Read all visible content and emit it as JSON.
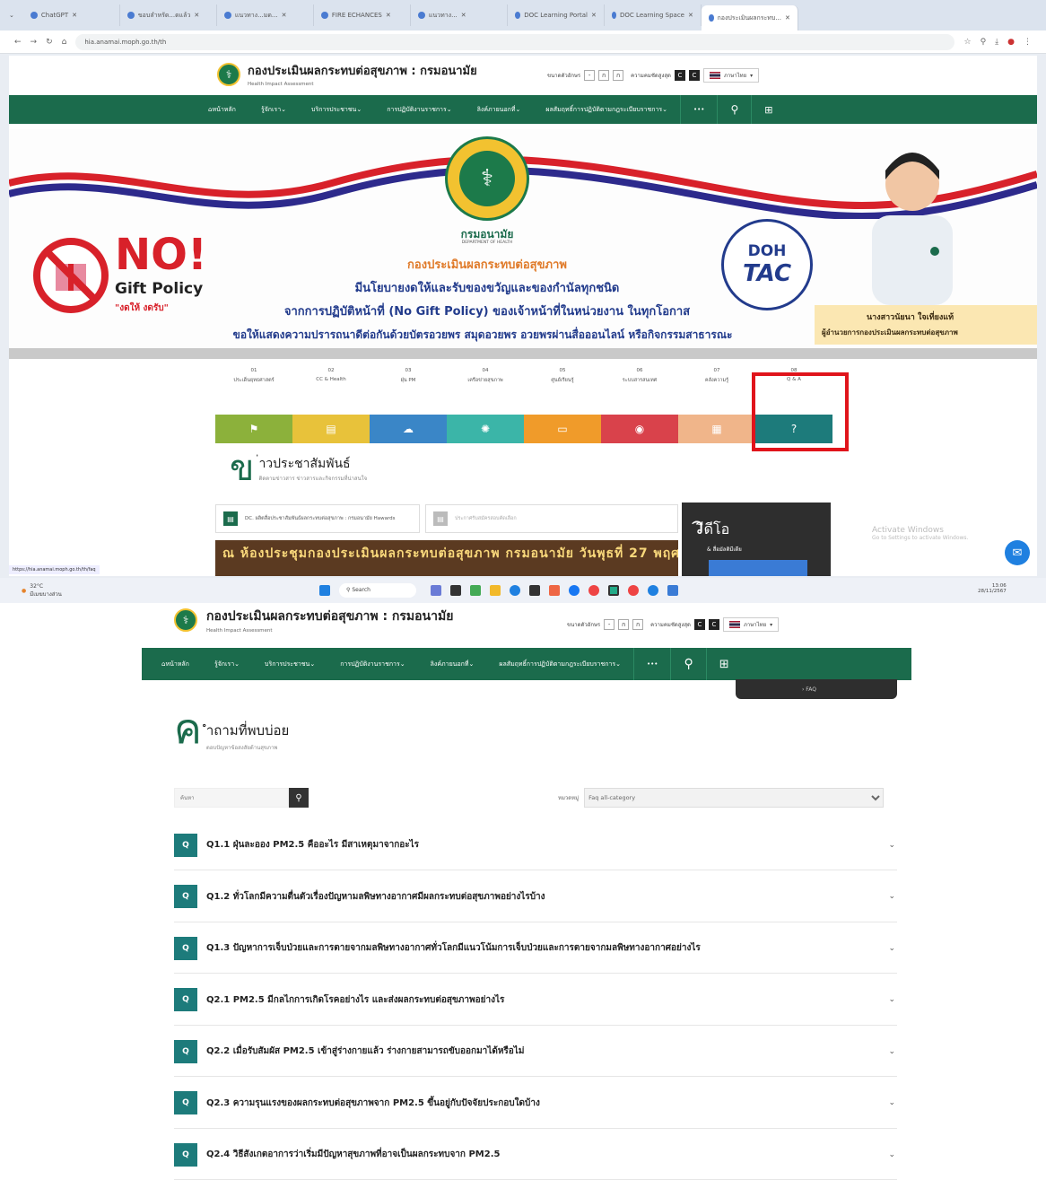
{
  "browser": {
    "tabs": [
      "ChatGPT",
      "ขอบลำหรัด...ดแล้ว",
      "แนวทาง...มด...",
      "FIRE ECHANCES",
      "แนวทาง...",
      "DOC Learning Portal",
      "DOC Learning Space",
      "กองประเมินผลกระทบ..."
    ],
    "url": "hia.anamai.moph.go.th/th"
  },
  "site": {
    "title": "กองประเมินผลกระทบต่อสุขภาพ : กรมอนามัย",
    "subtitle": "Health Impact Assessment",
    "font_size_label": "ขนาดตัวอักษร",
    "font_btns": [
      "-",
      "ก",
      "ก"
    ],
    "contrast_label": "ความคมชัดสูงสุด",
    "contrast_btns": [
      "C",
      "C"
    ],
    "language": "ภาษาไทย",
    "nav": [
      "หน้าหลัก",
      "รู้จักเรา",
      "บริการประชาชน",
      "การปฏิบัติงานราชการ",
      "ลิงค์ภายนอกที่",
      "ผลสัมฤทธิ์การปฏิบัติตามกฎระเบียบราชการ"
    ],
    "nav_more": "•••"
  },
  "banner": {
    "no_text": "NO!",
    "gift_policy": "Gift Policy",
    "gift_sub": "\"งดให้ งดรับ\"",
    "dept_name": "กรมอนามัย",
    "dept_en": "DEPARTMENT OF HEALTH",
    "line1": "กองประเมินผลกระทบต่อสุขภาพ",
    "line2": "มีนโยบายงดให้และรับของขวัญและของกำนัลทุกชนิด",
    "line3": "จากการปฏิบัติหน้าที่ (No Gift Policy) ของเจ้าหน้าที่ในหน่วยงาน ในทุกโอกาส",
    "line4": "ขอให้แสดงความปรารถนาดีต่อกันด้วยบัตรอวยพร สมุดอวยพร อวยพรผ่านสื่อออนไลน์ หรือกิจกรรมสาธารณะ",
    "doh_top": "DOH",
    "doh_main": "TAC",
    "person_name": "นางสาวนัยนา ใจเที่ยงแท้",
    "person_title": "ผู้อำนวยการกองประเมินผลกระทบต่อสุขภาพ"
  },
  "quicklinks": [
    {
      "num": "01",
      "label": "ประเด็นยุทธศาสตร์",
      "color": "#8cb13b",
      "icon": "⚑"
    },
    {
      "num": "02",
      "label": "CC & Health",
      "color": "#e8c23a",
      "icon": "▤"
    },
    {
      "num": "03",
      "label": "ฝุ่น PM",
      "color": "#3a86c7",
      "icon": "☁"
    },
    {
      "num": "04",
      "label": "เครือข่ายสุขภาพ",
      "color": "#3bb5a8",
      "icon": "✺"
    },
    {
      "num": "05",
      "label": "ศูนย์เรียนรู้",
      "color": "#f09b2a",
      "icon": "▭"
    },
    {
      "num": "06",
      "label": "ระบบสารสนเทศ",
      "color": "#d9424b",
      "icon": "◉"
    },
    {
      "num": "07",
      "label": "คลังความรู้",
      "color": "#f0b58a",
      "icon": "▦"
    },
    {
      "num": "08",
      "label": "Q & A",
      "color": "#1d7b7b",
      "icon": "?"
    }
  ],
  "news": {
    "heading_big": "ข",
    "heading": "่าวประชาสัมพันธ์",
    "sub": "ติดตามข่าวสาร ข่าวสารและกิจกรรมที่น่าสนใจ",
    "card1": "DC. ผลิตสื่อประชาสัมพันธ์ผลกระทบต่อสุขภาพ : กรมอนามัย Hawards",
    "card2": "ประกาศรับสมัครสอบคัดเลือก",
    "strip": "ณ ห้องประชุมกองประเมินผลกระทบต่อสุขภาพ กรมอนามัย วันพุธที่ 27 พฤศจิกายน 2568",
    "video_big": "ว",
    "video": "ีดีโอ",
    "video_sub": "& สื่อมัลติมีเดีย"
  },
  "windows": {
    "activate": "Activate Windows",
    "activate_sub": "Go to Settings to activate Windows.",
    "statusbar": "https://hia.anamai.moph.go.th/th/faq",
    "weather": "32°C",
    "weather_sub": "มีเมฆบางส่วน",
    "search": "Search",
    "time": "13:06",
    "date": "28/11/2567"
  },
  "faq_page": {
    "breadcrumb": "› FAQ",
    "heading_big": "ค",
    "heading": "ำถามที่พบบ่อย",
    "sub": "ตอบปัญหาข้อสงสัยด้านสุขภาพ",
    "search_placeholder": "ค้นหา",
    "category_label": "หมวดหมู่",
    "category_value": "Faq all-category",
    "items": [
      "Q1.1 ฝุ่นละออง PM2.5 คืออะไร มีสาเหตุมาจากอะไร",
      "Q1.2 ทั่วโลกมีความตื่นตัวเรื่องปัญหามลพิษทางอากาศมีผลกระทบต่อสุขภาพอย่างไรบ้าง",
      "Q1.3 ปัญหาการเจ็บป่วยและการตายจากมลพิษทางอากาศทั่วโลกมีแนวโน้มการเจ็บป่วยและการตายจากมลพิษทางอากาศอย่างไร",
      "Q2.1 PM2.5 มีกลไกการเกิดโรคอย่างไร และส่งผลกระทบต่อสุขภาพอย่างไร",
      "Q2.2 เมื่อรับสัมผัส PM2.5 เข้าสู่ร่างกายแล้ว ร่างกายสามารถขับออกมาได้หรือไม่",
      "Q2.3 ความรุนแรงของผลกระทบต่อสุขภาพจาก PM2.5 ขึ้นอยู่กับปัจจัยประกอบใดบ้าง",
      "Q2.4 วิธีสังเกตอาการว่าเริ่มมีปัญหาสุขภาพที่อาจเป็นผลกระทบจาก PM2.5"
    ],
    "q_badge": "Q"
  }
}
